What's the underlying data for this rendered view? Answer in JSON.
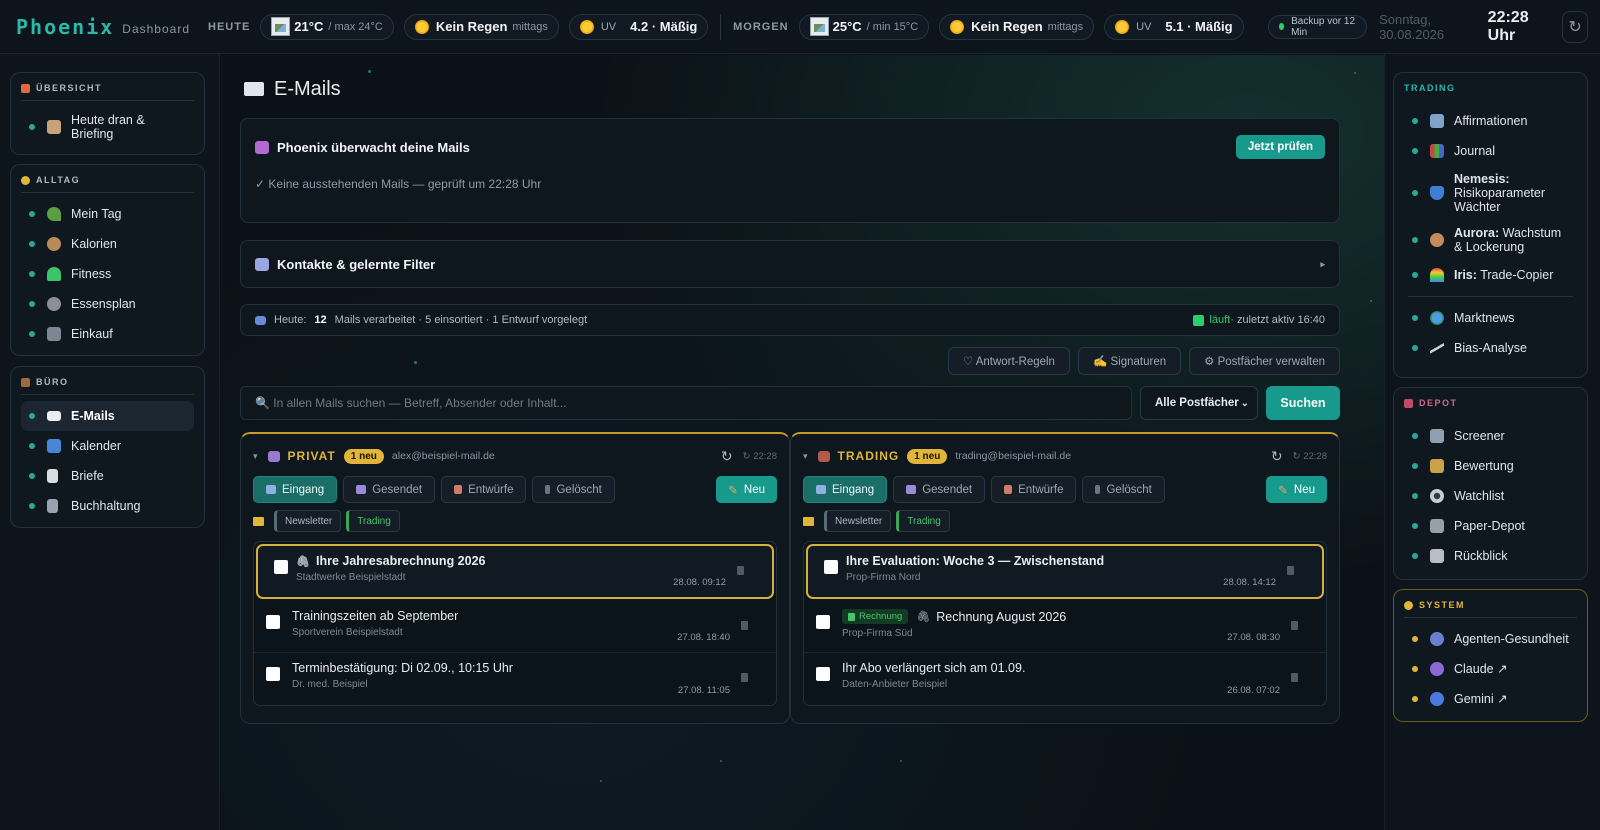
{
  "topbar": {
    "logo": "Phoenix",
    "logo_sub": "Dashboard",
    "today": {
      "label": "HEUTE",
      "temp": "21°C",
      "temp_range": "/ max 24°C",
      "rain": "Kein Regen",
      "rain_when": "mittags",
      "uv_label": "UV",
      "uv_value": "4.2 · Mäßig"
    },
    "tomorrow": {
      "label": "MORGEN",
      "temp": "25°C",
      "temp_range": "/ min 15°C",
      "rain": "Kein Regen",
      "rain_when": "mittags",
      "uv_label": "UV",
      "uv_value": "5.1 · Mäßig"
    },
    "backup": "Backup vor 12 Min",
    "date": "Sonntag, 30.08.2026",
    "time": "22:28 Uhr",
    "refresh_icon": "↻"
  },
  "left_nav": {
    "uebersicht": {
      "title": "ÜBERSICHT",
      "items": [
        {
          "label": "Heute dran & Briefing",
          "icon": "clipboard-icon"
        }
      ]
    },
    "alltag": {
      "title": "ALLTAG",
      "items": [
        {
          "label": "Mein Tag",
          "icon": "sprout-icon"
        },
        {
          "label": "Kalorien",
          "icon": "food-bowl-icon"
        },
        {
          "label": "Fitness",
          "icon": "heart-icon"
        },
        {
          "label": "Essensplan",
          "icon": "plate-icon"
        },
        {
          "label": "Einkauf",
          "icon": "cart-icon"
        }
      ]
    },
    "buero": {
      "title": "BÜRO",
      "items": [
        {
          "label": "E-Mails",
          "icon": "mail-icon",
          "active": true
        },
        {
          "label": "Kalender",
          "icon": "calendar-icon"
        },
        {
          "label": "Briefe",
          "icon": "letter-icon"
        },
        {
          "label": "Buchhaltung",
          "icon": "ledger-icon"
        }
      ]
    }
  },
  "right_nav": {
    "trading": {
      "title": "TRADING",
      "items": [
        {
          "label": "Affirmationen",
          "icon": "book-icon"
        },
        {
          "label": "Journal",
          "icon": "bar-chart-icon"
        },
        {
          "bold": "Nemesis:",
          "label": "Risikoparameter Wächter",
          "icon": "shield-icon"
        },
        {
          "bold": "Aurora:",
          "label": "Wachstum & Lockerung",
          "icon": "spiral-icon"
        },
        {
          "bold": "Iris:",
          "label": "Trade-Copier",
          "icon": "rainbow-icon"
        },
        {
          "label": "Marktnews",
          "icon": "globe-icon"
        },
        {
          "label": "Bias-Analyse",
          "icon": "trend-icon"
        }
      ]
    },
    "depot": {
      "title": "DEPOT",
      "items": [
        {
          "label": "Screener",
          "icon": "chart-icon"
        },
        {
          "label": "Bewertung",
          "icon": "scale-icon"
        },
        {
          "label": "Watchlist",
          "icon": "eye-icon"
        },
        {
          "label": "Paper-Depot",
          "icon": "hammer-icon"
        },
        {
          "label": "Rückblick",
          "icon": "robot-icon"
        }
      ]
    },
    "system": {
      "title": "SYSTEM",
      "items": [
        {
          "label": "Agenten-Gesundheit",
          "icon": "stethoscope-icon"
        },
        {
          "label": "Claude ↗",
          "icon": "claude-icon"
        },
        {
          "label": "Gemini ↗",
          "icon": "gemini-icon"
        }
      ]
    }
  },
  "main": {
    "title": "E-Mails",
    "watch": {
      "title": "Phoenix überwacht deine Mails",
      "button": "Jetzt prüfen",
      "status": "✓ Keine ausstehenden Mails — geprüft um 22:28 Uhr"
    },
    "contacts": {
      "title": "Kontakte & gelernte Filter",
      "toggle": "▸"
    },
    "stats": {
      "prefix": "Heute:",
      "count": "12",
      "text": "Mails verarbeitet · 5 einsortiert · 1 Entwurf vorgelegt",
      "running": "läuft",
      "last_active": " · zuletzt aktiv 16:40"
    },
    "actions": {
      "rules": "♡ Antwort-Regeln",
      "signatures": "✍ Signaturen",
      "manage": "⚙ Postfächer verwalten"
    },
    "search": {
      "placeholder": "🔍 In allen Mails suchen — Betreff, Absender oder Inhalt...",
      "select": "Alle Postfächer",
      "button": "Suchen"
    }
  },
  "mailboxes": [
    {
      "name": "PRIVAT",
      "badge": "1 neu",
      "address": "alex@beispiel-mail.de",
      "refresh_time": "↻ 22:28",
      "tabs": [
        "Eingang",
        "Gesendet",
        "Entwürfe",
        "Gelöscht"
      ],
      "new_button": "Neu",
      "filters": [
        "Newsletter",
        "Trading"
      ],
      "mails": [
        {
          "subject": "Ihre Jahresabrechnung 2026",
          "sender": "Stadtwerke Beispielstadt",
          "date": "28.08. 09:12",
          "attachment": true,
          "tag": ""
        },
        {
          "subject": "Trainingszeiten ab September",
          "sender": "Sportverein Beispielstadt",
          "date": "27.08. 18:40",
          "attachment": false,
          "tag": ""
        },
        {
          "subject": "Terminbestätigung: Di 02.09., 10:15 Uhr",
          "sender": "Dr. med. Beispiel",
          "date": "27.08. 11:05",
          "attachment": false,
          "tag": ""
        }
      ]
    },
    {
      "name": "TRADING",
      "badge": "1 neu",
      "address": "trading@beispiel-mail.de",
      "refresh_time": "↻ 22:28",
      "tabs": [
        "Eingang",
        "Gesendet",
        "Entwürfe",
        "Gelöscht"
      ],
      "new_button": "Neu",
      "filters": [
        "Newsletter",
        "Trading"
      ],
      "mails": [
        {
          "subject": "Ihre Evaluation: Woche 3 — Zwischenstand",
          "sender": "Prop-Firma Nord",
          "date": "28.08. 14:12",
          "attachment": false,
          "tag": ""
        },
        {
          "subject": "Rechnung August 2026",
          "sender": "Prop-Firma Süd",
          "date": "27.08. 08:30",
          "attachment": true,
          "tag": "Rechnung"
        },
        {
          "subject": "Ihr Abo verlängert sich am 01.09.",
          "sender": "Daten-Anbieter Beispiel",
          "date": "26.08. 07:02",
          "attachment": false,
          "tag": ""
        }
      ]
    }
  ],
  "colors": {
    "accent": "#179a8c",
    "gold": "#e0b53a",
    "background": "#0b1118"
  }
}
